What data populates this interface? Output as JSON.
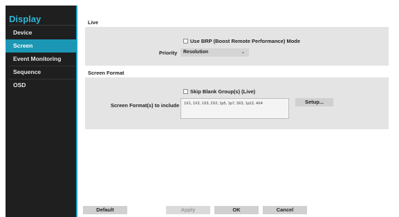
{
  "sidebar": {
    "title": "Display",
    "items": [
      {
        "label": "Device",
        "selected": false
      },
      {
        "label": "Screen",
        "selected": true
      },
      {
        "label": "Event Monitoring",
        "selected": false
      },
      {
        "label": "Sequence",
        "selected": false
      },
      {
        "label": "OSD",
        "selected": false
      }
    ]
  },
  "live": {
    "title": "Live",
    "brp_label": "Use BRP (Boost Remote Performance) Mode",
    "brp_checked": false,
    "priority_label": "Priority",
    "priority_value": "Resolution",
    "priority_arrow": "⌄"
  },
  "screen_format": {
    "title": "Screen Format",
    "skip_label": "Skip Blank Group(s) (Live)",
    "skip_checked": false,
    "include_label": "Screen Format(s) to include",
    "include_value": "1X1, 1X2, 1X3, 2X2, 1p5, 1p7, 3X3, 1p12, 4X4",
    "setup_label": "Setup..."
  },
  "footer": {
    "default_label": "Default",
    "apply_label": "Apply",
    "ok_label": "OK",
    "cancel_label": "Cancel"
  },
  "colors": {
    "accent": "#1b97b5",
    "sidebar_bg": "#1f1f1f",
    "panel_bg": "#e4e4e4"
  }
}
